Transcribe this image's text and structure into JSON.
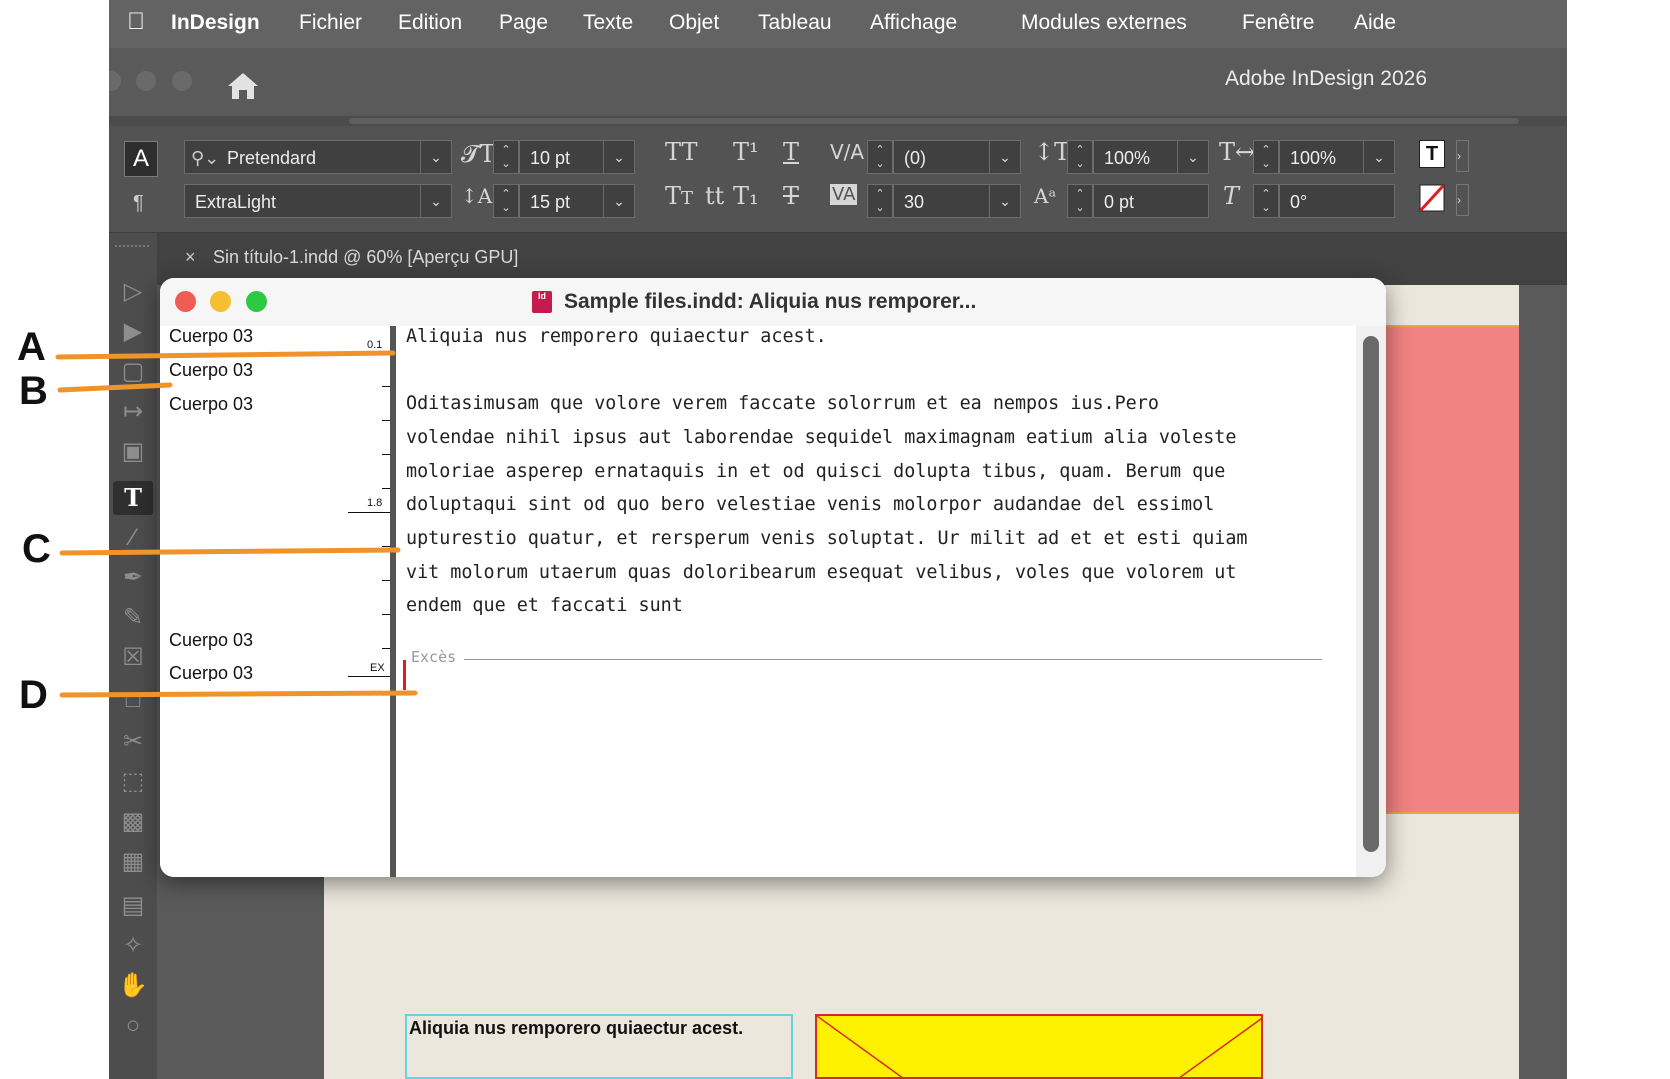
{
  "menubar": {
    "apple_icon": "apple-logo-icon",
    "app_name": "InDesign",
    "items": [
      "Fichier",
      "Edition",
      "Page",
      "Texte",
      "Objet",
      "Tableau",
      "Affichage",
      "Modules externes",
      "Fenêtre",
      "Aide"
    ]
  },
  "titlebar": {
    "app_title": "Adobe InDesign 2026",
    "home_icon": "home-icon"
  },
  "control": {
    "font_family": "Pretendard",
    "font_style": "ExtraLight",
    "font_size": "10 pt",
    "leading": "15 pt",
    "kerning": "(0)",
    "tracking": "30",
    "vertical_scale": "100%",
    "horizontal_scale": "100%",
    "baseline_shift": "0 pt",
    "skew": "0°"
  },
  "doc_tab": {
    "close": "×",
    "label": "Sin título-1.indd @ 60% [Aperçu GPU]"
  },
  "story_editor": {
    "title": "Sample files.indd: Aliquia nus remporer...",
    "badge": "Id",
    "info_styles": [
      "Cuerpo 03",
      "Cuerpo 03",
      "Cuerpo 03",
      "Cuerpo 03",
      "Cuerpo 03"
    ],
    "depth_marks": [
      "0.1",
      "1.8",
      "EX"
    ],
    "lines": [
      "Aliquia nus remporero quiaectur acest.",
      "",
      "Oditasimusam que volore verem faccate solorrum et ea nempos ius.Pero",
      "volendae nihil ipsus aut laborendae sequidel maximagnam eatium alia voleste",
      "moloriae asperep ernataquis in et od quisci dolupta tibus, quam. Berum que",
      "doluptaqui sint od quo bero velestiae venis molorpor audandae del essimol",
      "upturestio quatur, et rersperum venis soluptat. Ur milit ad et et esti quiam",
      "vit molorum utaerum quas doloribearum esequat velibus, voles que volorem ut",
      "endem que et faccati sunt"
    ],
    "excess_label": "Excès"
  },
  "layout_frame": {
    "text": "Aliquia nus remporero quiaectur acest."
  },
  "callouts": [
    "A",
    "B",
    "C",
    "D"
  ],
  "colors": {
    "callout": "#f0932b",
    "pink_frame": "#f38282",
    "yellow_frame": "#fff200",
    "cursor": "#e01e1e"
  }
}
